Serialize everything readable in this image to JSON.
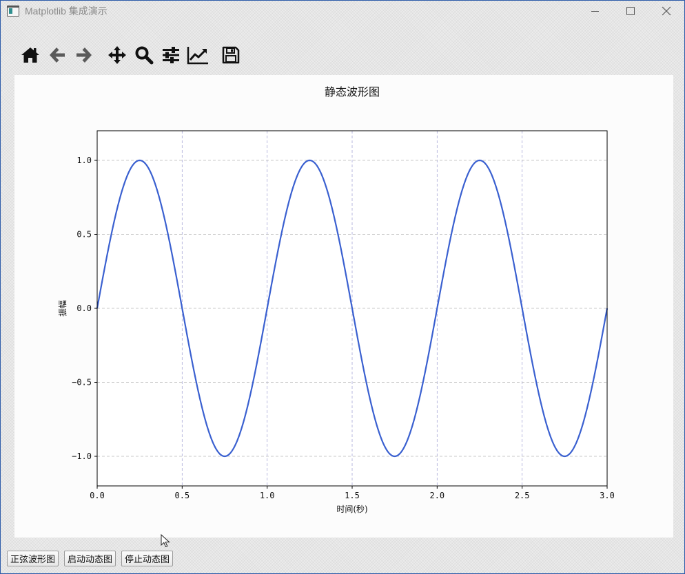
{
  "window": {
    "title": "Matplotlib 集成演示",
    "controls": [
      "minimize",
      "maximize",
      "close"
    ]
  },
  "toolbar": {
    "buttons": [
      {
        "name": "home",
        "icon": "home-icon"
      },
      {
        "name": "back",
        "icon": "arrow-left-icon"
      },
      {
        "name": "forward",
        "icon": "arrow-right-icon"
      },
      {
        "name": "pan",
        "icon": "move-arrows-icon"
      },
      {
        "name": "zoom",
        "icon": "magnifier-icon"
      },
      {
        "name": "subplots",
        "icon": "sliders-icon"
      },
      {
        "name": "customize",
        "icon": "line-chart-icon"
      },
      {
        "name": "save",
        "icon": "floppy-disk-icon"
      }
    ]
  },
  "chart_data": {
    "type": "line",
    "title": "静态波形图",
    "xlabel": "时间(秒)",
    "ylabel": "振幅",
    "xlim": [
      0,
      3
    ],
    "ylim": [
      -1.2,
      1.2
    ],
    "xticks": [
      0,
      0.5,
      1,
      1.5,
      2,
      2.5,
      3
    ],
    "xtick_labels": [
      "0.0",
      "0.5",
      "1.0",
      "1.5",
      "2.0",
      "2.5",
      "3.0"
    ],
    "yticks": [
      1,
      0.5,
      0,
      -0.5,
      -1
    ],
    "ytick_labels": [
      "1.0",
      "0.5",
      "0.0",
      "−0.5",
      "−1.0"
    ],
    "grid": true,
    "series": [
      {
        "function": "sin(2*pi*t)",
        "frequency_hz": 1,
        "amplitude": 1,
        "color": "#3a60d0",
        "x": [
          0,
          0.25,
          0.5,
          0.75,
          1,
          1.25,
          1.5,
          1.75,
          2,
          2.25,
          2.5,
          2.75,
          3
        ],
        "y": [
          0,
          1,
          0,
          -1,
          0,
          1,
          0,
          -1,
          0,
          1,
          0,
          -1,
          0
        ]
      }
    ]
  },
  "bottom_buttons": [
    {
      "label": "正弦波形图"
    },
    {
      "label": "启动动态图"
    },
    {
      "label": "停止动态图"
    }
  ],
  "colors": {
    "line": "#3a60d0",
    "grid": "#b8b8b8",
    "panel": "#fcfcfc",
    "toolbar_icon": "#111111",
    "toolbar_icon_disabled": "#5a5a5a"
  }
}
